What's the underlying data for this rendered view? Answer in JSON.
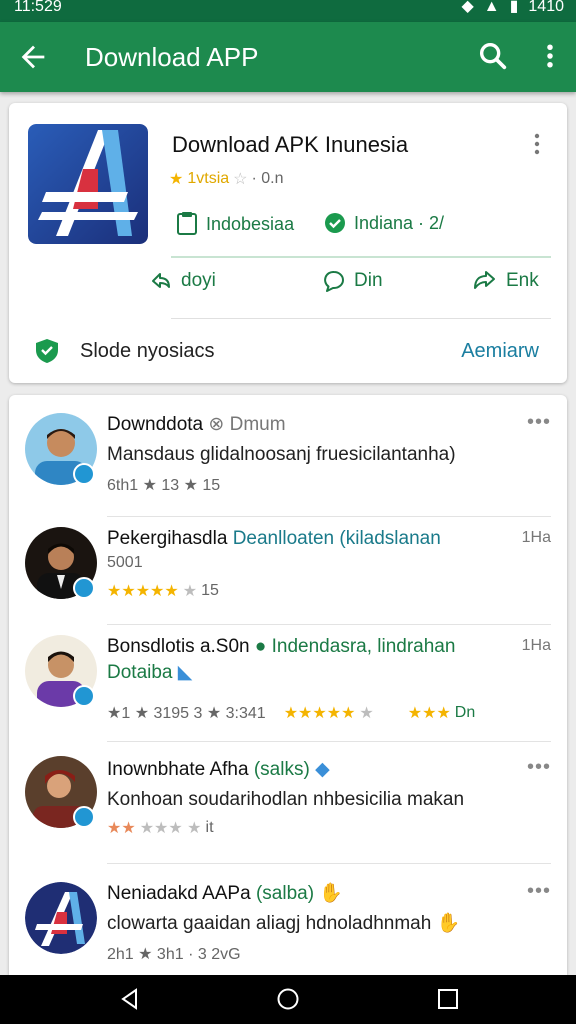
{
  "status_bar": {
    "time": "11:529",
    "right_text": "1410"
  },
  "app_bar": {
    "title": "Download APP"
  },
  "app_card": {
    "name": "Download APK Inunesia",
    "rating_text": "1vtsia",
    "rating_extra": "· 0.n",
    "tag1": "Indobesiaa",
    "tag2": "Indiana · 2/",
    "action1": "doyi",
    "action2": "Din",
    "action3": "Enk",
    "bottom_label": "Slode nyosiacs",
    "bottom_link": "Aemiarw"
  },
  "reviews": [
    {
      "name": "Downddota",
      "extra": "Dmum",
      "text": "Mansdaus glidalnoosanj fruesicilantanha)",
      "meta": "6th1 ★ 13 ★ 15"
    },
    {
      "name": "Pekergihasdla",
      "extra": "Deanlloaten (kiladslanan",
      "time": "1Ha",
      "text": "5001",
      "meta": "15"
    },
    {
      "name": "Bonsdlotis a.S0n",
      "extra": "Indendasra, lindrahan",
      "time": "1Ha",
      "text": "Dotaiba",
      "meta1": "★1 ★ 3195 3 ★ 3:341",
      "meta2": "Dn"
    },
    {
      "name": "Inownbhate Afha",
      "extra": "(salks)",
      "text": "Konhoan soudarihodlan nhbesicilia makan",
      "meta": "it"
    },
    {
      "name": "Neniadakd AAPa",
      "extra": "(salba)",
      "text": "clowarta gaaidan aliagj hdnoladhnmah",
      "meta": "2h1 ★ 3h1 · 3 2vG"
    }
  ],
  "colors": {
    "status_bar": "#0f6b3f",
    "app_bar": "#1d8a4e",
    "accent_green": "#1b7a45",
    "link_blue": "#1a7ea0",
    "star": "#f4b400"
  }
}
